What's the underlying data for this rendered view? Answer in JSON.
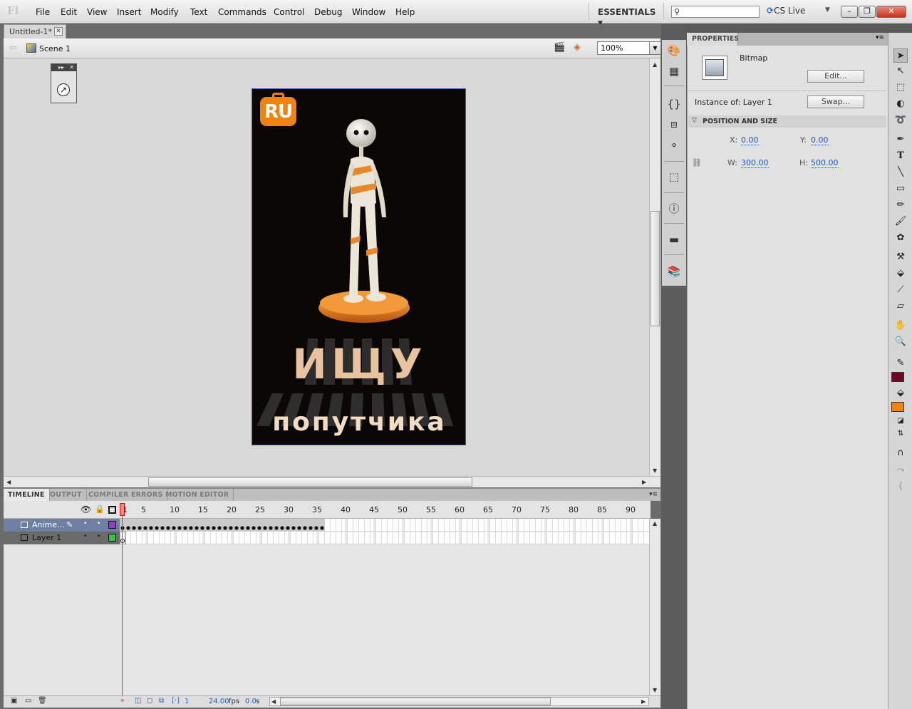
{
  "app": {
    "logo": "Fl"
  },
  "menu": [
    "File",
    "Edit",
    "View",
    "Insert",
    "Modify",
    "Text",
    "Commands",
    "Control",
    "Debug",
    "Window",
    "Help"
  ],
  "workspace": {
    "label": "ESSENTIALS"
  },
  "search": {
    "placeholder": ""
  },
  "cslive": {
    "label": "CS Live"
  },
  "window_controls": {
    "minimize": "–",
    "restore": "❐",
    "close": "✕"
  },
  "document": {
    "tab": "Untitled-1*",
    "scene": "Scene 1",
    "zoom": "100%"
  },
  "artwork": {
    "badge": "RU",
    "headline": "ИЩУ",
    "subline": "попутчика",
    "bg_color": "#0a0706",
    "accent": "#f08310"
  },
  "timeline": {
    "tabs": [
      "TIMELINE",
      "OUTPUT",
      "COMPILER ERRORS",
      "MOTION EDITOR"
    ],
    "ruler": [
      "1",
      "5",
      "10",
      "15",
      "20",
      "25",
      "30",
      "35",
      "40",
      "45",
      "50",
      "55",
      "60",
      "65",
      "70",
      "75",
      "80",
      "85",
      "90"
    ],
    "layers": [
      {
        "name": "Anime...",
        "color": "#8e3ec9",
        "selected": true
      },
      {
        "name": "Layer 1",
        "color": "#2ec63a",
        "selected": false
      }
    ],
    "footer": {
      "frame": "1",
      "fps": "24.00",
      "fps_unit": "fps",
      "time": "0.0",
      "time_unit": "s"
    }
  },
  "properties": {
    "tab": "PROPERTIES",
    "type": "Bitmap",
    "edit_button": "Edit...",
    "instance_label": "Instance of:",
    "instance_value": "Layer 1",
    "swap_button": "Swap...",
    "section": "POSITION AND SIZE",
    "x_label": "X:",
    "x": "0.00",
    "y_label": "Y:",
    "y": "0.00",
    "w_label": "W:",
    "w": "300.00",
    "h_label": "H:",
    "h": "500.00"
  },
  "tools": {
    "stroke_color": "#6b0a22",
    "fill_color": "#f08310"
  }
}
